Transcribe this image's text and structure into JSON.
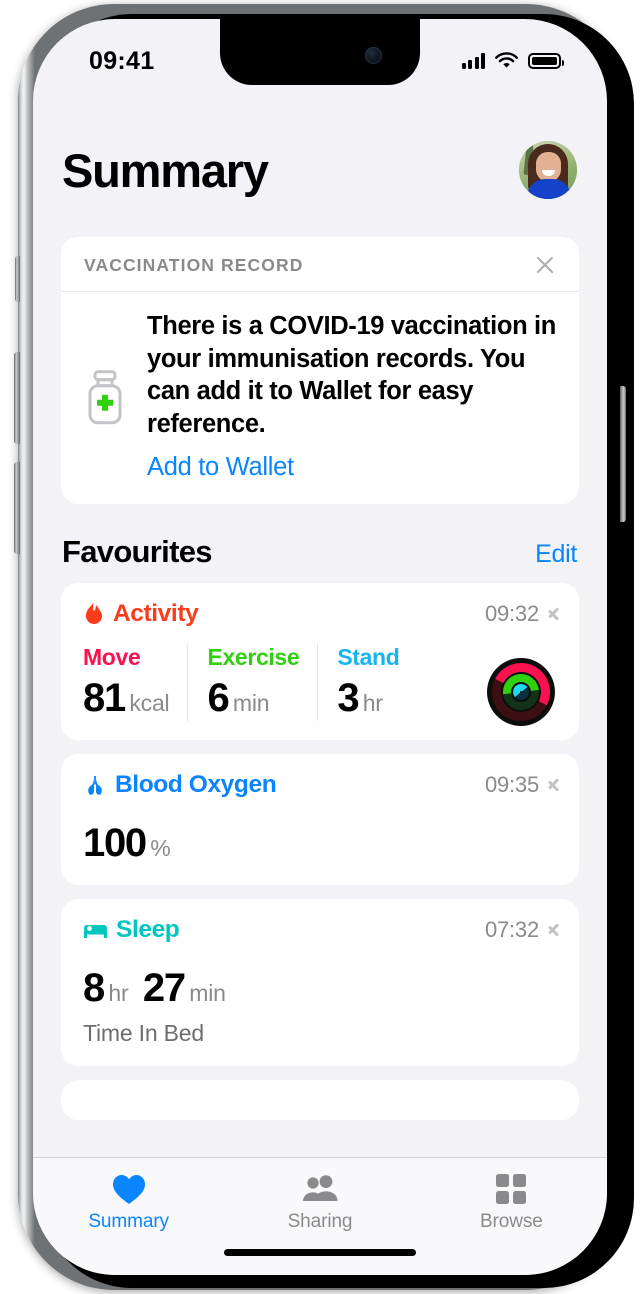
{
  "status_bar": {
    "time": "09:41",
    "cellular_icon": "cellular-bars-icon",
    "wifi_icon": "wifi-icon",
    "battery_icon": "battery-icon"
  },
  "header": {
    "title": "Summary",
    "avatar_name": "profile-avatar"
  },
  "vaccination_card": {
    "section_label": "VACCINATION RECORD",
    "close_icon": "close-icon",
    "vial_icon": "vaccine-vial-icon",
    "message": "There is a COVID-19 vaccination in your immunisation records. You can add it to Wallet for easy reference.",
    "action_label": "Add to Wallet"
  },
  "favourites": {
    "title": "Favourites",
    "edit_label": "Edit",
    "cards": [
      {
        "name": "activity",
        "title": "Activity",
        "icon": "flame-icon",
        "title_color": "#fa3c1d",
        "time": "09:32",
        "columns": [
          {
            "label": "Move",
            "label_color": "#fa114f",
            "value": "81",
            "unit": "kcal"
          },
          {
            "label": "Exercise",
            "label_color": "#2fd10e",
            "value": "6",
            "unit": "min"
          },
          {
            "label": "Stand",
            "label_color": "#18b4f0",
            "value": "3",
            "unit": "hr"
          }
        ],
        "rings_icon": "activity-rings"
      },
      {
        "name": "blood-oxygen",
        "title": "Blood Oxygen",
        "icon": "lungs-icon",
        "title_color": "#0a84ff",
        "time": "09:35",
        "value": "100",
        "unit": "%"
      },
      {
        "name": "sleep",
        "title": "Sleep",
        "icon": "bed-icon",
        "title_color": "#00c7be",
        "time": "07:32",
        "hours": "8",
        "hours_unit": "hr",
        "minutes": "27",
        "minutes_unit": "min",
        "subtitle": "Time In Bed"
      }
    ]
  },
  "tab_bar": {
    "tabs": [
      {
        "label": "Summary",
        "icon": "heart-icon",
        "active": true
      },
      {
        "label": "Sharing",
        "icon": "people-icon",
        "active": false
      },
      {
        "label": "Browse",
        "icon": "grid-icon",
        "active": false
      }
    ]
  },
  "colors": {
    "background": "#f2f2f7",
    "card": "#ffffff",
    "accent_blue": "#0a84ff",
    "secondary_text": "#8a8a8e"
  }
}
